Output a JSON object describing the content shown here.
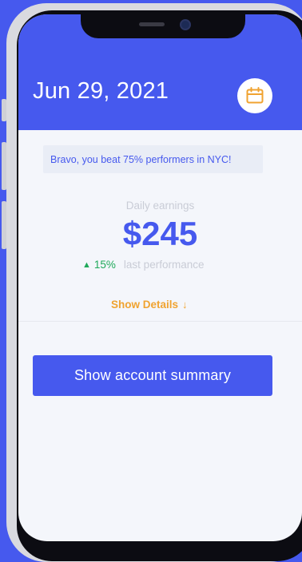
{
  "header": {
    "date": "Jun 29, 2021",
    "calendar_icon": "calendar-icon"
  },
  "banner": {
    "text": "Bravo, you beat 75% performers in NYC!"
  },
  "earnings": {
    "label": "Daily earnings",
    "amount": "$245",
    "delta_icon": "triangle-up-icon",
    "delta_value": "15%",
    "delta_label": "last performance"
  },
  "details": {
    "label": "Show Details",
    "arrow": "↓"
  },
  "summary_button": {
    "label": "Show account summary"
  },
  "colors": {
    "brand": "#4659ee",
    "positive": "#1fa95a",
    "accent": "#f0a330"
  }
}
